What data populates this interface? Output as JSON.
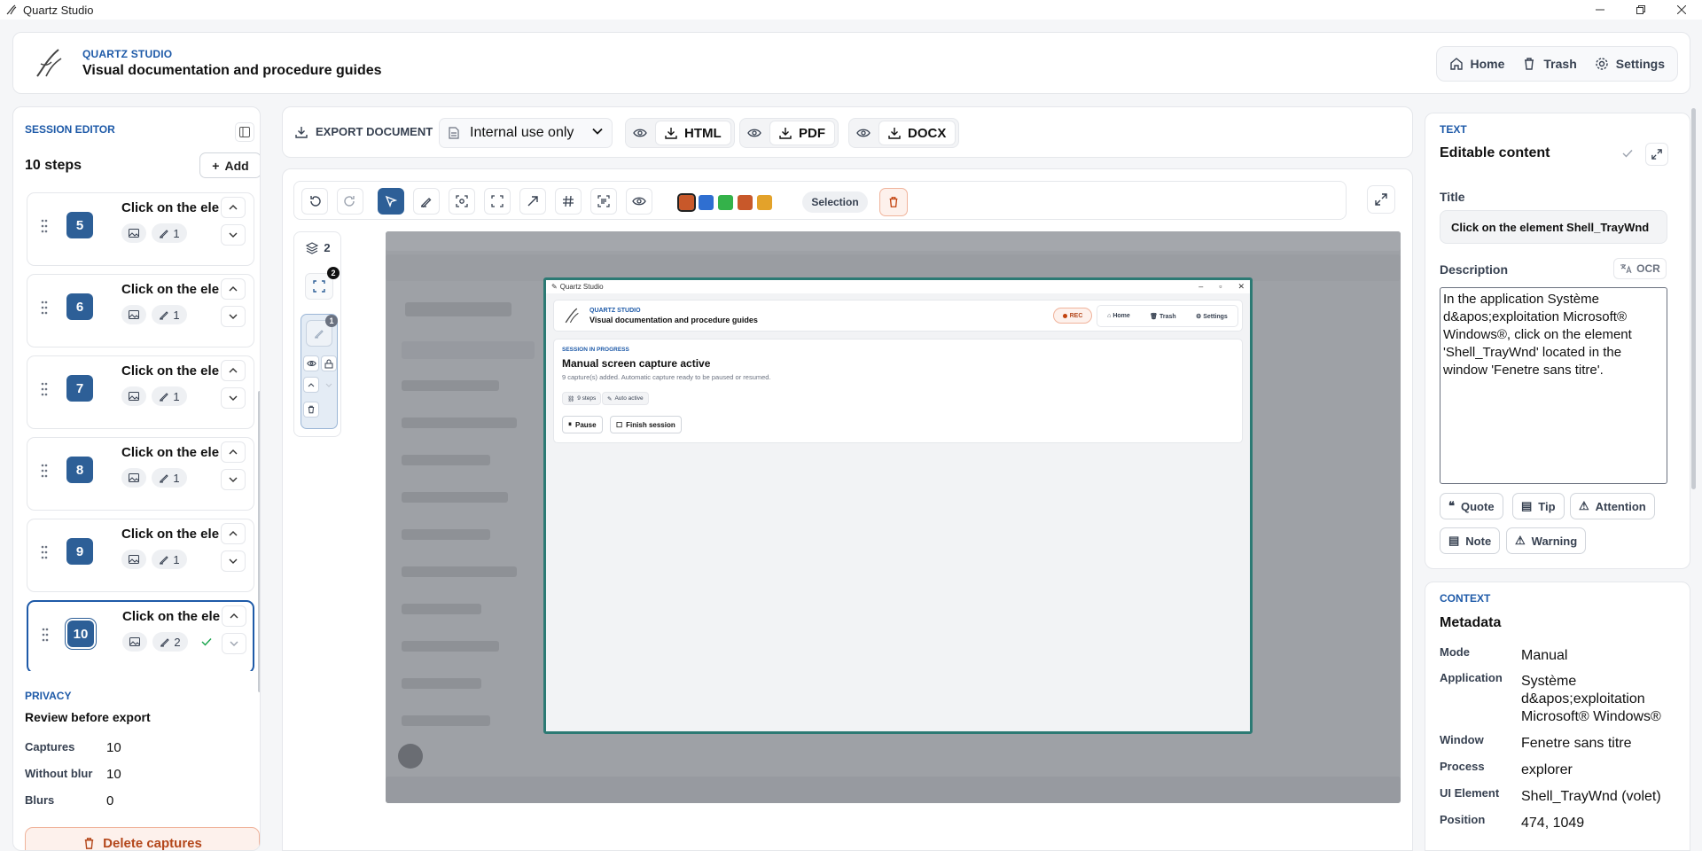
{
  "window": {
    "title": "Quartz Studio"
  },
  "header": {
    "brand_sub": "QUARTZ STUDIO",
    "brand_title": "Visual documentation and procedure guides",
    "nav": [
      {
        "label": "Home",
        "icon": "home-icon"
      },
      {
        "label": "Trash",
        "icon": "trash-icon"
      },
      {
        "label": "Settings",
        "icon": "gear-icon"
      }
    ]
  },
  "session_editor": {
    "label": "SESSION EDITOR",
    "steps_count": "10 steps",
    "add_label": "Add",
    "steps": [
      {
        "number": "5",
        "title": "Click on the element Shell_TrayWnd",
        "annotations": "1"
      },
      {
        "number": "6",
        "title": "Click on the element Shell_TrayWnd",
        "annotations": "1"
      },
      {
        "number": "7",
        "title": "Click on the element Shell_TrayWnd",
        "annotations": "1"
      },
      {
        "number": "8",
        "title": "Click on the element Shell_TrayWnd",
        "annotations": "1"
      },
      {
        "number": "9",
        "title": "Click on the element Shell_TrayWnd",
        "annotations": "1"
      },
      {
        "number": "10",
        "title": "Click on the element Shell_TrayWnd",
        "annotations": "2",
        "active": true
      }
    ]
  },
  "privacy": {
    "label": "PRIVACY",
    "title": "Review before export",
    "rows": [
      {
        "key": "Captures",
        "value": "10"
      },
      {
        "key": "Without blur",
        "value": "10"
      },
      {
        "key": "Blurs",
        "value": "0"
      }
    ],
    "delete_label": "Delete captures"
  },
  "export": {
    "label": "EXPORT DOCUMENT",
    "visibility": "Internal use only",
    "formats": [
      "HTML",
      "PDF",
      "DOCX"
    ]
  },
  "toolbar": {
    "selection_label": "Selection",
    "colors": [
      "#c8582a",
      "#2f6fd1",
      "#34b24a",
      "#c8582a",
      "#e3a22a"
    ]
  },
  "layers": {
    "count": "2",
    "crop_badge": "2",
    "item_badge": "1"
  },
  "capture": {
    "window_title": "Quartz Studio",
    "brand_sub": "QUARTZ STUDIO",
    "brand_title": "Visual documentation and procedure guides",
    "rec": "REC",
    "nav": [
      "Home",
      "Trash",
      "Settings"
    ],
    "session_label": "SESSION IN PROGRESS",
    "heading": "Manual screen capture active",
    "subtext": "9 capture(s) added. Automatic capture ready to be paused or resumed.",
    "chips": [
      "9 steps",
      "Auto active"
    ],
    "buttons": [
      "Pause",
      "Finish session"
    ]
  },
  "text_panel": {
    "label": "TEXT",
    "title": "Editable content",
    "title_field_label": "Title",
    "title_value": "Click on the element Shell_TrayWnd",
    "description_label": "Description",
    "ocr_label": "OCR",
    "description": "In the application Système d&apos;exploitation Microsoft® Windows®, click on the element 'Shell_TrayWnd' located in the window 'Fenetre sans titre'.",
    "tags": [
      "Quote",
      "Tip",
      "Attention",
      "Note",
      "Warning"
    ]
  },
  "context": {
    "label": "CONTEXT",
    "title": "Metadata",
    "rows": [
      {
        "key": "Mode",
        "value": "Manual"
      },
      {
        "key": "Application",
        "value": "Système d&apos;exploitation Microsoft® Windows®"
      },
      {
        "key": "Window",
        "value": "Fenetre sans titre"
      },
      {
        "key": "Process",
        "value": "explorer"
      },
      {
        "key": "UI Element",
        "value": "Shell_TrayWnd (volet)"
      },
      {
        "key": "Position",
        "value": "474, 1049"
      }
    ]
  }
}
